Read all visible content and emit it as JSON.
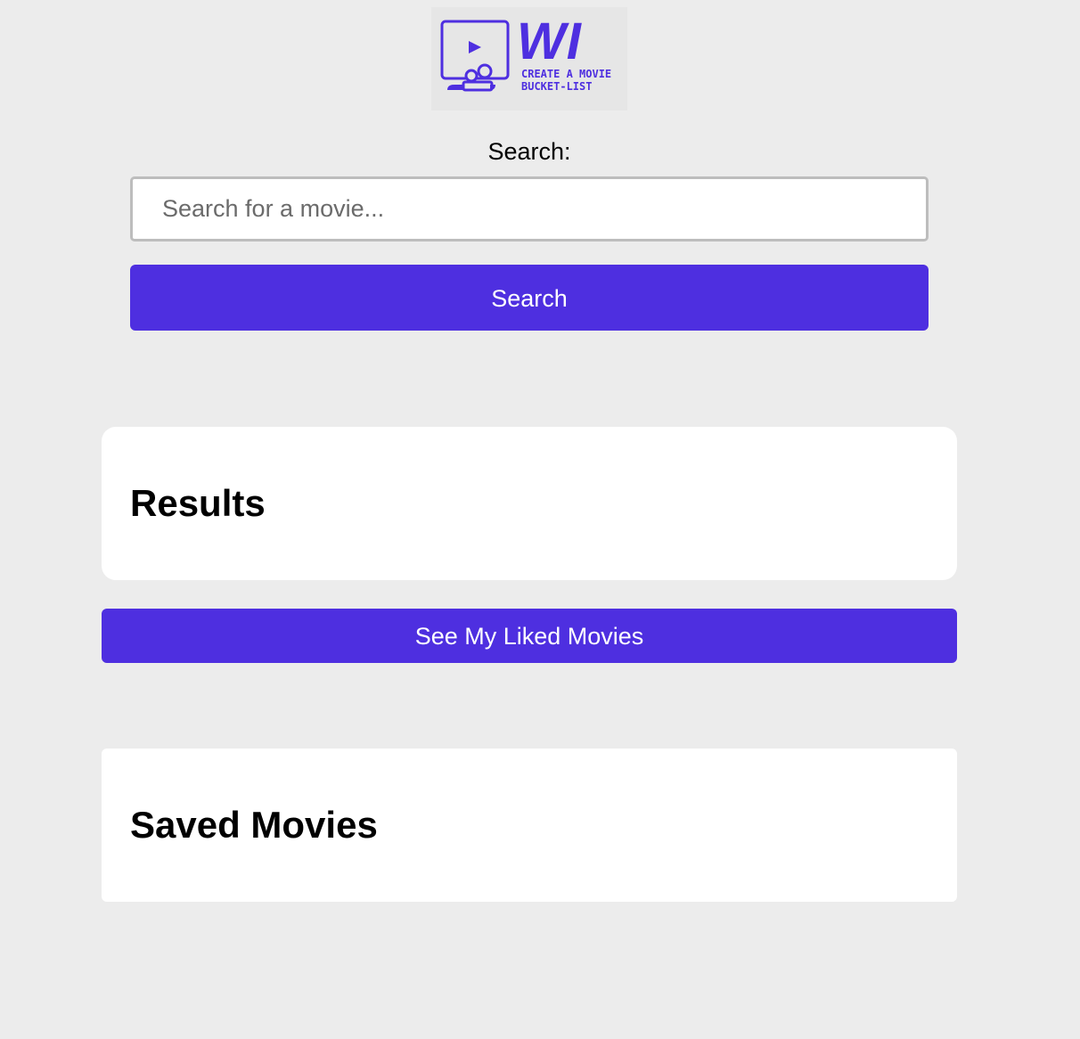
{
  "logo": {
    "wordmark": "WI",
    "tagline_line1": "CREATE A MOVIE",
    "tagline_line2": "BUCKET-LIST",
    "icon": "movie-screen-audience-icon"
  },
  "search": {
    "label": "Search:",
    "placeholder": "Search for a movie...",
    "value": "",
    "button_label": "Search"
  },
  "results": {
    "heading": "Results"
  },
  "liked": {
    "button_label": "See My Liked Movies"
  },
  "saved": {
    "heading": "Saved Movies"
  },
  "colors": {
    "accent": "#4e2fe0",
    "background": "#ececec",
    "panel": "#ffffff"
  }
}
